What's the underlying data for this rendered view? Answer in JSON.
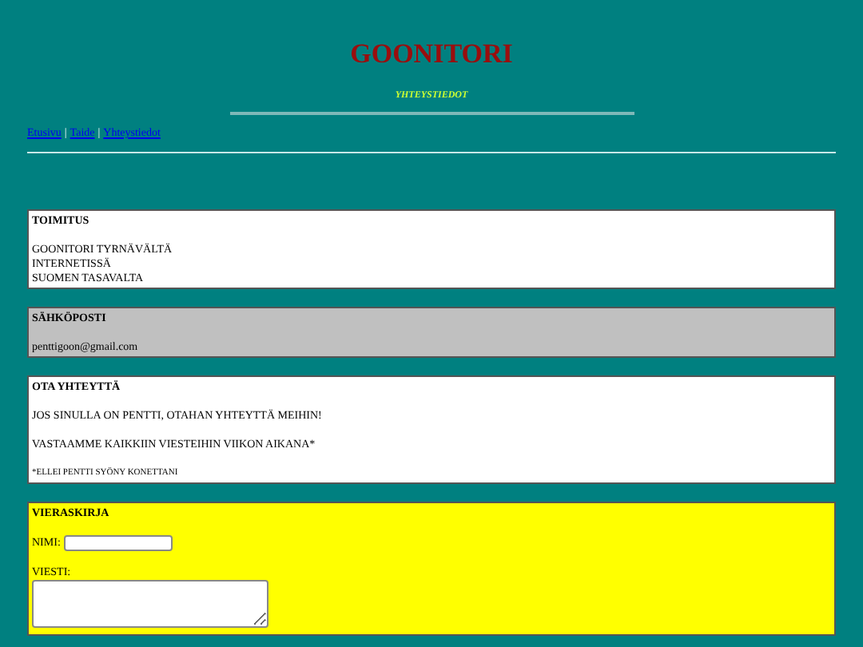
{
  "header": {
    "title": "GOONITORI",
    "subtitle": "YHTEYSTIEDOT"
  },
  "nav": {
    "links": [
      "Etusivu",
      "Taide",
      "Yhteystiedot"
    ],
    "separator": "|"
  },
  "sections": [
    {
      "kind": "info",
      "color": "#ffffff",
      "heading": "TOIMITUS",
      "paragraphs": [
        {
          "lines": [
            "GOONITORI TYRNÄVÄLTÄ",
            "INTERNETISSÄ",
            "SUOMEN TASAVALTA"
          ],
          "small": false
        }
      ]
    },
    {
      "kind": "info",
      "color": "#c0c0c0",
      "heading": "SÄHKÖPOSTI",
      "paragraphs": [
        {
          "lines": [
            "penttigoon@gmail.com"
          ],
          "small": false
        }
      ]
    },
    {
      "kind": "info",
      "color": "#ffffff",
      "heading": "OTA YHTEYTTÄ",
      "paragraphs": [
        {
          "lines": [
            "JOS SINULLA ON PENTTI, OTAHAN YHTEYTTÄ MEIHIN!"
          ],
          "small": false
        },
        {
          "lines": [
            "VASTAAMME KAIKKIIN VIESTEIHIN VIIKON AIKANA*"
          ],
          "small": false
        },
        {
          "lines": [
            "*ELLEI PENTTI SYÖNY KONETTANI"
          ],
          "small": true
        }
      ]
    },
    {
      "kind": "form",
      "color": "#ffff00",
      "heading": "VIERASKIRJA",
      "fields": [
        {
          "kind": "line",
          "label": "NIMI:"
        },
        {
          "kind": "area",
          "label": "VIESTI:"
        }
      ]
    }
  ]
}
